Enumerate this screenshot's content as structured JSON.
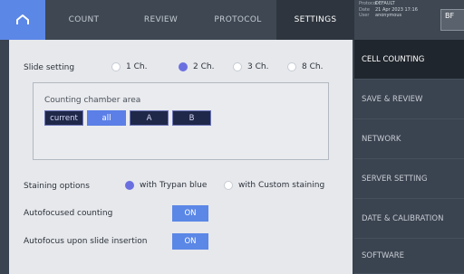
{
  "topbar": {
    "tabs": [
      {
        "label": "COUNT"
      },
      {
        "label": "REVIEW"
      },
      {
        "label": "PROTOCOL"
      },
      {
        "label": "SETTINGS"
      }
    ],
    "info": {
      "protocol_key": "Protocol",
      "protocol_val": "DEFAULT",
      "date_key": "Date",
      "date_val": "21 Apr 2023 17:16",
      "user_key": "User",
      "user_val": "anonymous"
    },
    "mode_label": "BF"
  },
  "slide_setting": {
    "label": "Slide setting",
    "options": [
      "1 Ch.",
      "2 Ch.",
      "3 Ch.",
      "8 Ch."
    ],
    "selected": "2 Ch."
  },
  "chamber_area": {
    "caption": "Counting chamber area",
    "buttons": [
      "current",
      "all",
      "A",
      "B"
    ],
    "selected": "all"
  },
  "staining": {
    "label": "Staining options",
    "options": [
      "with Trypan blue",
      "with Custom staining"
    ],
    "selected": "with Trypan blue"
  },
  "autofocus_counting": {
    "label": "Autofocused counting",
    "state": "ON"
  },
  "autofocus_slide": {
    "label": "Autofocus upon slide insertion",
    "state": "ON"
  },
  "menu": {
    "items": [
      {
        "label": "CELL COUNTING"
      },
      {
        "label": "SAVE & REVIEW"
      },
      {
        "label": "NETWORK"
      },
      {
        "label": "SERVER SETTING"
      },
      {
        "label": "DATE & CALIBRATION"
      },
      {
        "label": "SOFTWARE"
      }
    ],
    "active": "CELL COUNTING"
  },
  "colors": {
    "accent": "#5b87e6",
    "radio_selected": "#6a6fe0",
    "panel": "#e6e8ec",
    "chrome": "#3a4350"
  }
}
